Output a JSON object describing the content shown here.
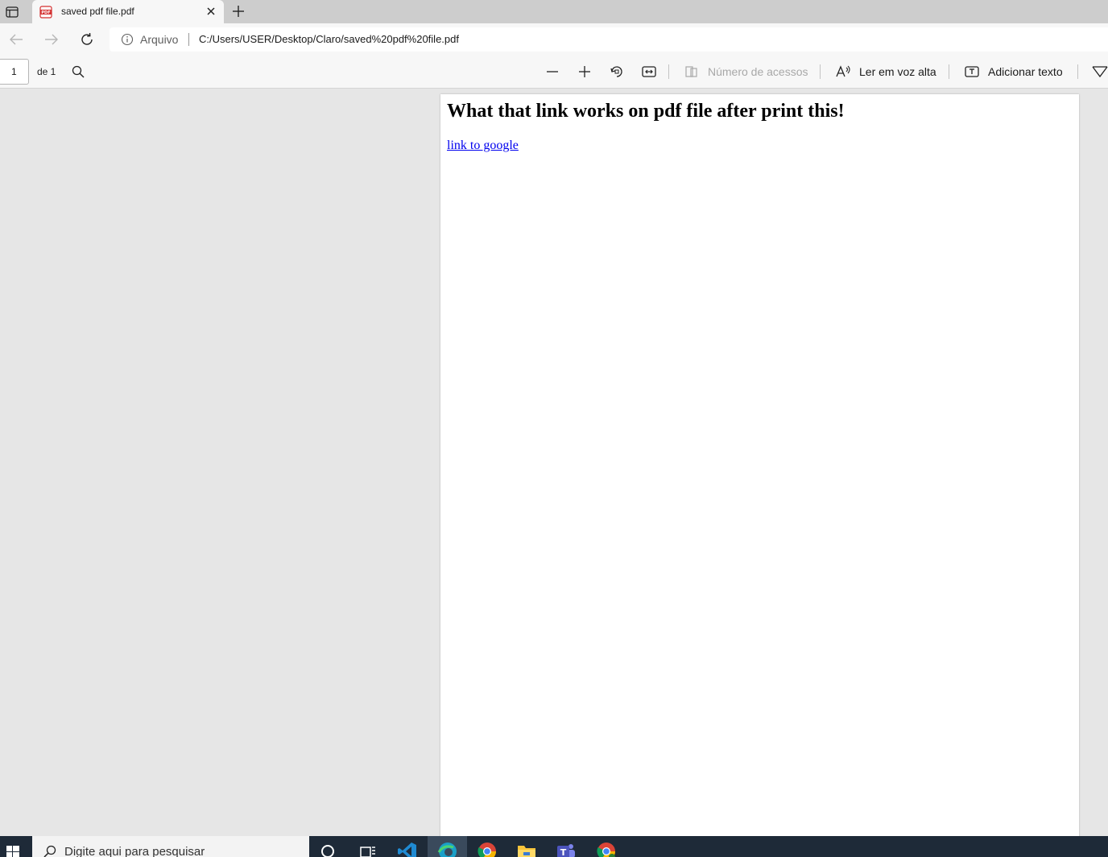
{
  "browser": {
    "tab": {
      "title": "saved pdf file.pdf",
      "favicon_text": "PDF"
    },
    "address": {
      "scheme_label": "Arquivo",
      "url": "C:/Users/USER/Desktop/Claro/saved%20pdf%20file.pdf"
    }
  },
  "pdf_toolbar": {
    "page_number": "1",
    "page_total": "de 1",
    "page_view_label": "Número de acessos",
    "read_aloud_label": "Ler em voz alta",
    "add_text_label": "Adicionar texto"
  },
  "document": {
    "heading": "What that link works on pdf file after print this!",
    "link_text": "link to google"
  },
  "taskbar": {
    "search_placeholder": "Digite aqui para pesquisar",
    "teams_letter": "T"
  },
  "colors": {
    "link": "#0000ee",
    "taskbar": "#1e2a38",
    "pdf_red": "#d32f2f"
  }
}
